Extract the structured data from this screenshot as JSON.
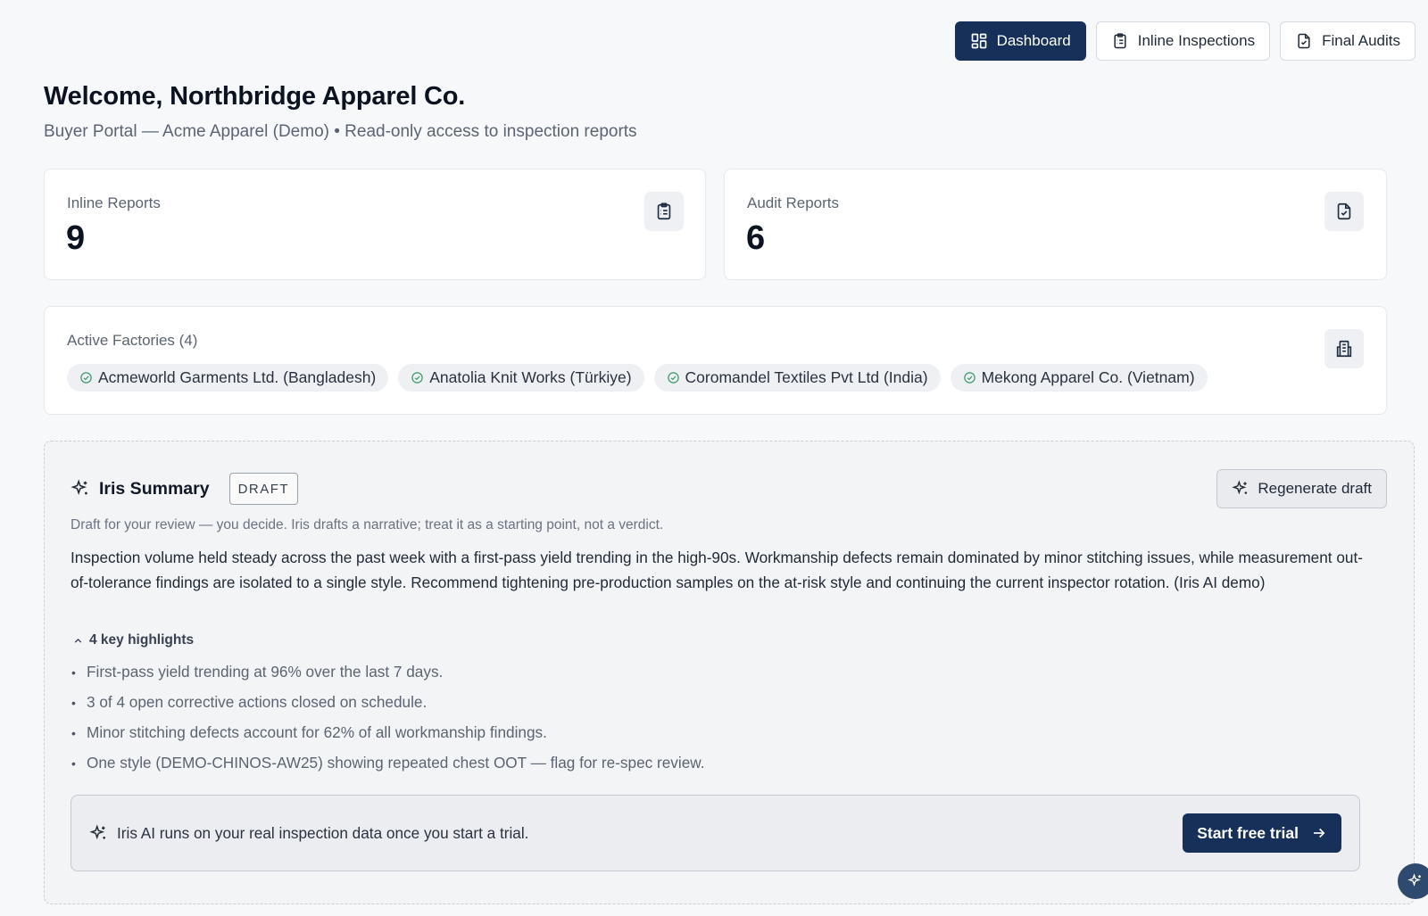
{
  "nav": {
    "dashboard": "Dashboard",
    "inline_inspections": "Inline Inspections",
    "final_audits": "Final Audits",
    "active_color": "#16305a"
  },
  "header": {
    "title": "Welcome, Northbridge Apparel Co.",
    "subtitle": "Buyer Portal — Acme Apparel (Demo) • Read-only access to inspection reports"
  },
  "stats": {
    "inline": {
      "label": "Inline Reports",
      "value": "9",
      "icon": "clipboard-list-icon"
    },
    "audit": {
      "label": "Audit Reports",
      "value": "6",
      "icon": "file-check-icon"
    }
  },
  "factories": {
    "label": "Active Factories (4)",
    "icon": "building-icon",
    "items": [
      "Acmeworld Garments Ltd. (Bangladesh)",
      "Anatolia Knit Works (Türkiye)",
      "Coromandel Textiles Pvt Ltd (India)",
      "Mekong Apparel Co. (Vietnam)"
    ],
    "check_color": "#3d9a6a"
  },
  "iris": {
    "title": "Iris Summary",
    "badge": "DRAFT",
    "regenerate_label": "Regenerate draft",
    "note": "Draft for your review — you decide. Iris drafts a narrative; treat it as a starting point, not a verdict.",
    "body": "Inspection volume held steady across the past week with a first-pass yield trending in the high-90s. Workmanship defects remain dominated by minor stitching issues, while measurement out-of-tolerance findings are isolated to a single style. Recommend tightening pre-production samples on the at-risk style and continuing the current inspector rotation. (Iris AI demo)",
    "highlights_label": "4 key highlights",
    "highlights": [
      "First-pass yield trending at 96% over the last 7 days.",
      "3 of 4 open corrective actions closed on schedule.",
      "Minor stitching defects account for 62% of all workmanship findings.",
      "One style (DEMO-CHINOS-AW25) showing repeated chest OOT — flag for re-spec review."
    ],
    "trial_text": "Iris AI runs on your real inspection data once you start a trial.",
    "trial_button": "Start free trial"
  }
}
